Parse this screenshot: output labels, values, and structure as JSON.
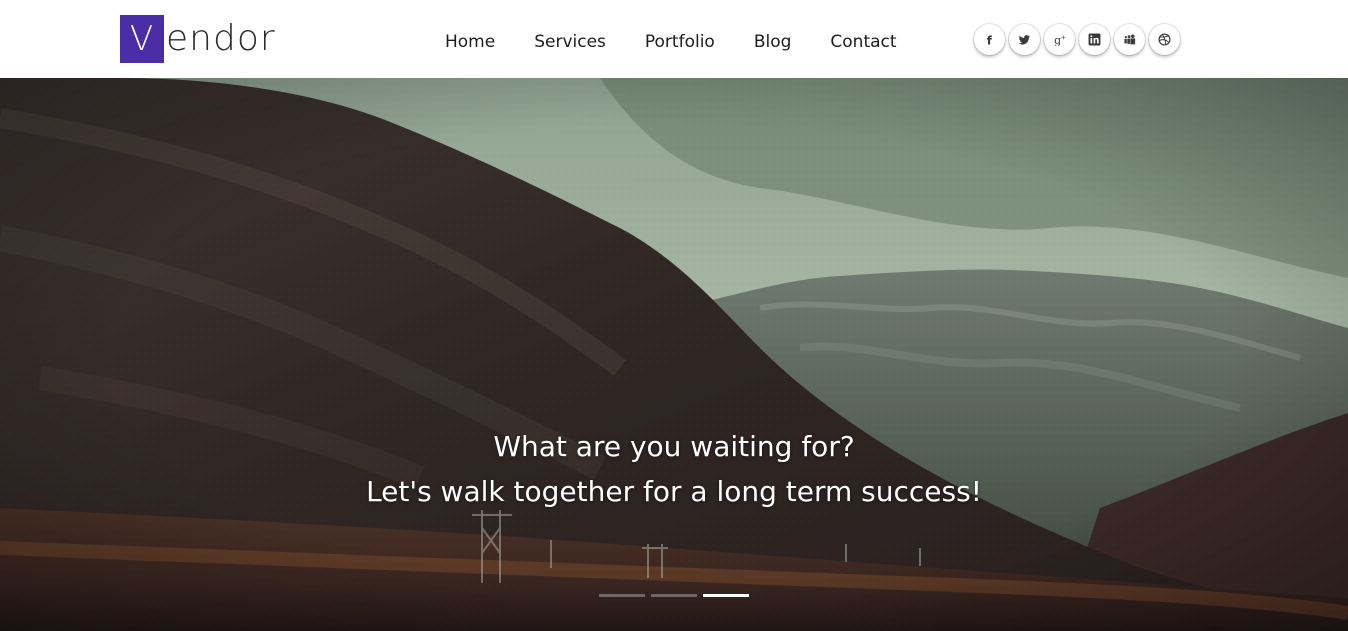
{
  "brand": {
    "logo_letter": "V",
    "logo_rest": "endor",
    "accent": "#4b2ea6"
  },
  "nav": {
    "items": [
      {
        "label": "Home"
      },
      {
        "label": "Services"
      },
      {
        "label": "Portfolio"
      },
      {
        "label": "Blog"
      },
      {
        "label": "Contact"
      }
    ]
  },
  "social": {
    "icons": [
      "facebook-icon",
      "twitter-icon",
      "google-plus-icon",
      "linkedin-icon",
      "myspace-icon",
      "dribbble-icon"
    ],
    "glyphs": [
      "f",
      "",
      "g+",
      "in",
      "",
      ""
    ]
  },
  "hero": {
    "line1": "What are you waiting for?",
    "line2": "Let's walk together for a long term success!",
    "slides_total": 3,
    "active_slide": 3
  }
}
